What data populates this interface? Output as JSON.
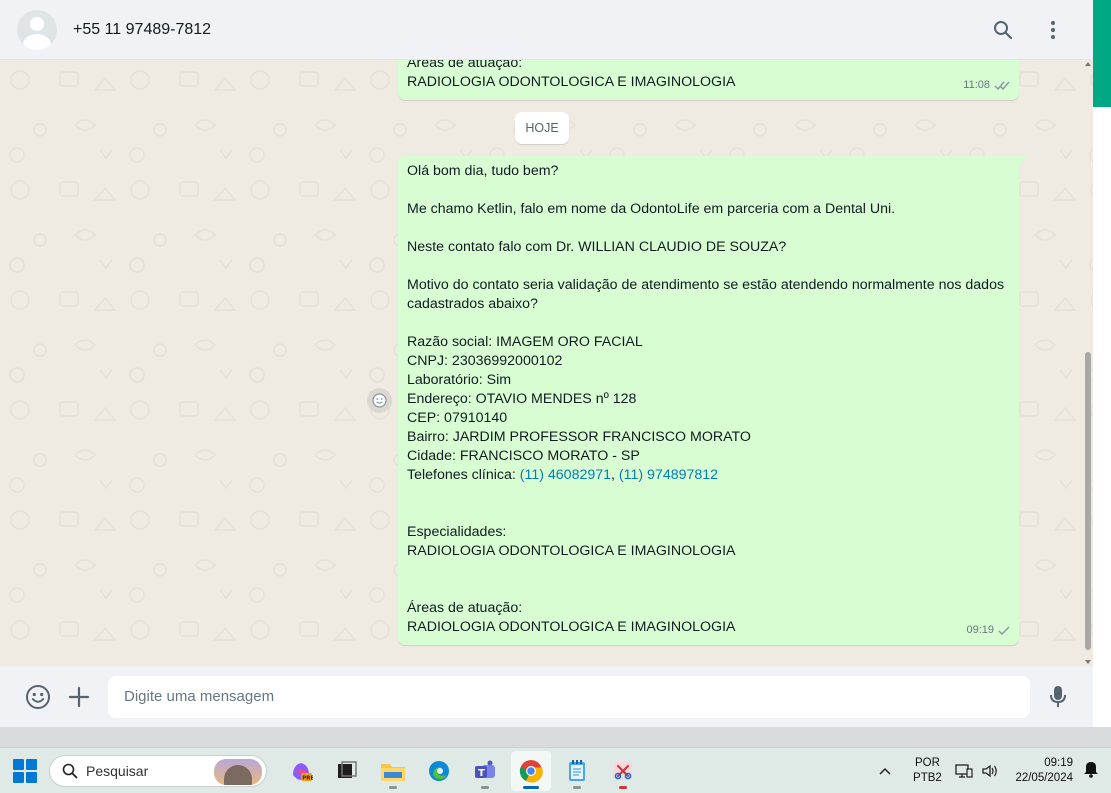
{
  "header": {
    "contact": "+55 11 97489-7812",
    "icons": [
      "search-icon",
      "menu-icon"
    ]
  },
  "chat": {
    "prev_message": {
      "lines": [
        "Áreas de atuação:",
        "RADIOLOGIA ODONTOLOGICA E IMAGINOLOGIA"
      ],
      "time": "11:08"
    },
    "date_chip": "HOJE",
    "message": {
      "lines": [
        "Olá bom dia, tudo bem?",
        "",
        "Me chamo Ketlin, falo em nome da OdontoLife em parceria com a Dental Uni.",
        "",
        "Neste contato falo com Dr. WILLIAN CLAUDIO DE SOUZA?",
        "",
        "Motivo do contato seria validação de atendimento se estão atendendo normalmente nos dados",
        "cadastrados abaixo?",
        "",
        "Razão social: IMAGEM ORO FACIAL",
        "CNPJ: 23036992000102",
        "Laboratório: Sim",
        "Endereço: OTAVIO MENDES nº 128",
        "CEP: 07910140",
        "Bairro: JARDIM PROFESSOR FRANCISCO MORATO",
        "Cidade: FRANCISCO MORATO - SP"
      ],
      "phones_label": "Telefones clínica: ",
      "phone1": "(11) 46082971",
      "phone_sep": ", ",
      "phone2": "(11) 974897812",
      "tail_lines": [
        "",
        "",
        "Especialidades:",
        "RADIOLOGIA ODONTOLOGICA E IMAGINOLOGIA",
        "",
        "",
        "Áreas de atuação:",
        "RADIOLOGIA ODONTOLOGICA E IMAGINOLOGIA"
      ],
      "time": "09:19"
    }
  },
  "compose": {
    "placeholder": "Digite uma mensagem"
  },
  "taskbar": {
    "search_label": "Pesquisar",
    "lang_line1": "POR",
    "lang_line2": "PTB2",
    "time": "09:19",
    "date": "22/05/2024",
    "apps": [
      "copilot-icon",
      "task-view-icon",
      "file-explorer-icon",
      "edge-icon",
      "teams-icon",
      "chrome-icon",
      "notepad-icon",
      "snipping-tool-icon"
    ]
  },
  "colors": {
    "bubble": "#d9fdd3",
    "chat_bg": "#efeae2",
    "accent": "#00a884",
    "link": "#027eb5"
  }
}
